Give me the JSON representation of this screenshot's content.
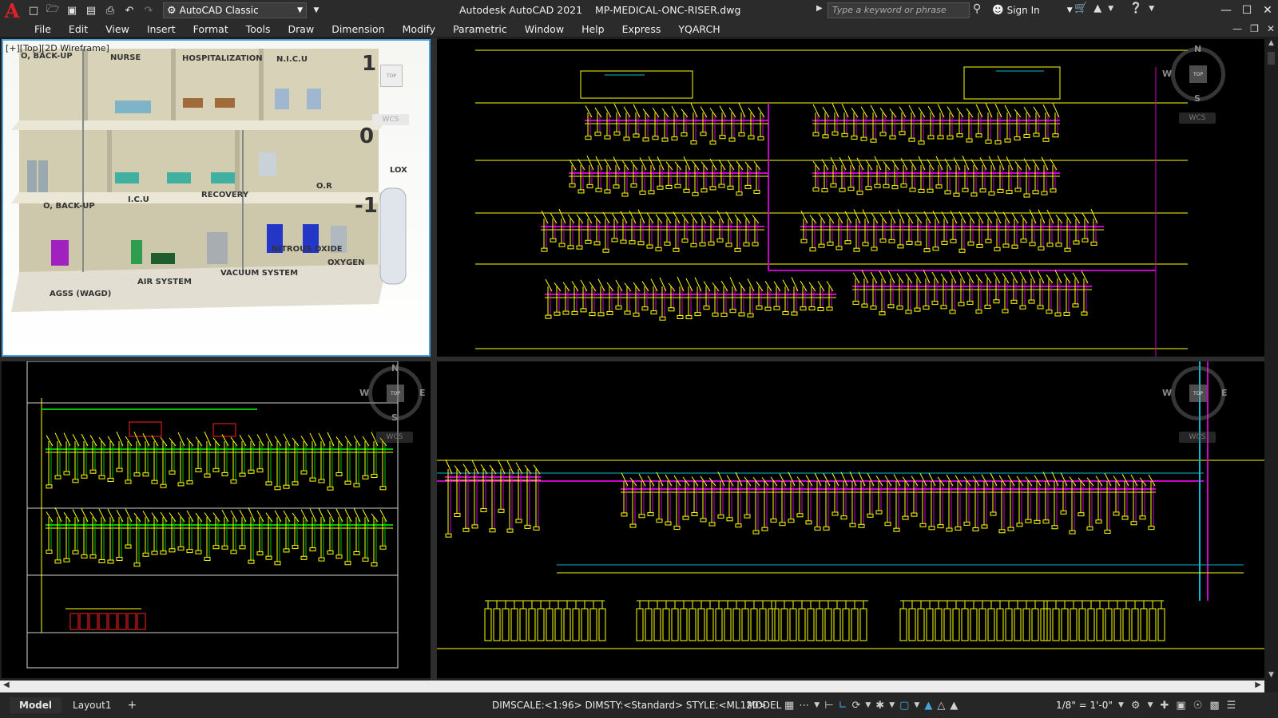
{
  "app": {
    "logo": "A",
    "workspace": "AutoCAD Classic",
    "title": "Autodesk AutoCAD 2021",
    "filename": "MP-MEDICAL-ONC-RISER.dwg",
    "search_placeholder": "Type a keyword or phrase",
    "sign_in": "Sign In"
  },
  "menu": [
    "File",
    "Edit",
    "View",
    "Insert",
    "Format",
    "Tools",
    "Draw",
    "Dimension",
    "Modify",
    "Parametric",
    "Window",
    "Help",
    "Express",
    "YQARCH"
  ],
  "viewports": {
    "top_left_label": "[+][Top][2D Wireframe]",
    "wcs": "WCS",
    "compass": {
      "n": "N",
      "s": "S",
      "e": "E",
      "w": "W",
      "cube": "TOP"
    },
    "building": {
      "labels": [
        "O, BACK-UP",
        "NURSE",
        "HOSPITALIZATION",
        "N.I.C.U",
        "I.C.U",
        "RECOVERY",
        "O.R",
        "O, BACK-UP",
        "LOX",
        "NITROUS OXIDE",
        "OXYGEN",
        "VACUUM SYSTEM",
        "AIR SYSTEM",
        "AGSS (WAGD)"
      ],
      "floor_numbers": [
        "1",
        "0",
        "-1"
      ]
    }
  },
  "status": {
    "tabs": [
      "Model",
      "Layout1"
    ],
    "add_tab": "+",
    "command": "DIMSCALE:<1:96> DIMSTY:<Standard> STYLE:<ML120>",
    "model": "MODEL",
    "scale": "1/8\" = 1'-0\""
  },
  "colors": {
    "drawing_yellow": "#ffff00",
    "drawing_magenta": "#cc00cc",
    "drawing_green": "#00c000",
    "drawing_cyan": "#00bcd4",
    "drawing_red": "#ff2020",
    "active_viewport_border": "#4aa3df",
    "logo_red": "#e3202a"
  }
}
